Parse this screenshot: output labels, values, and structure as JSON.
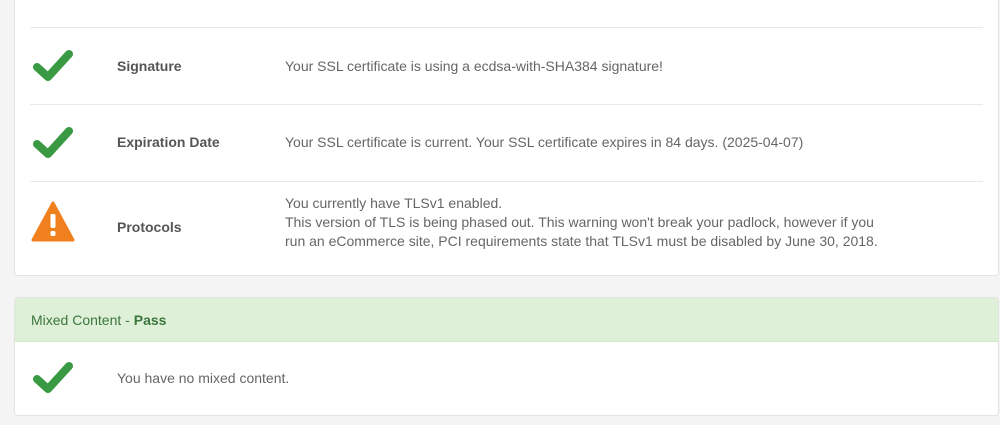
{
  "rows": [
    {
      "icon": "check-icon",
      "label": "Signature",
      "message": "Your SSL certificate is using a ecdsa-with-SHA384 signature!"
    },
    {
      "icon": "check-icon",
      "label": "Expiration Date",
      "message": "Your SSL certificate is current. Your SSL certificate expires in 84 days. (2025-04-07)"
    },
    {
      "icon": "warning-icon",
      "label": "Protocols",
      "message_lines": [
        "You currently have TLSv1 enabled.",
        "This version of TLS is being phased out. This warning won't break your padlock, however if you",
        "run an eCommerce site, PCI requirements state that TLSv1 must be disabled by June 30, 2018."
      ]
    }
  ],
  "mixed_content": {
    "title": "Mixed Content",
    "separator": " - ",
    "status": "Pass",
    "icon": "check-icon",
    "message": "You have no mixed content."
  },
  "colors": {
    "check": "#3a9a43",
    "warning": "#f07f1e",
    "pass_bg": "#dff0d8",
    "pass_text": "#3c763d"
  }
}
